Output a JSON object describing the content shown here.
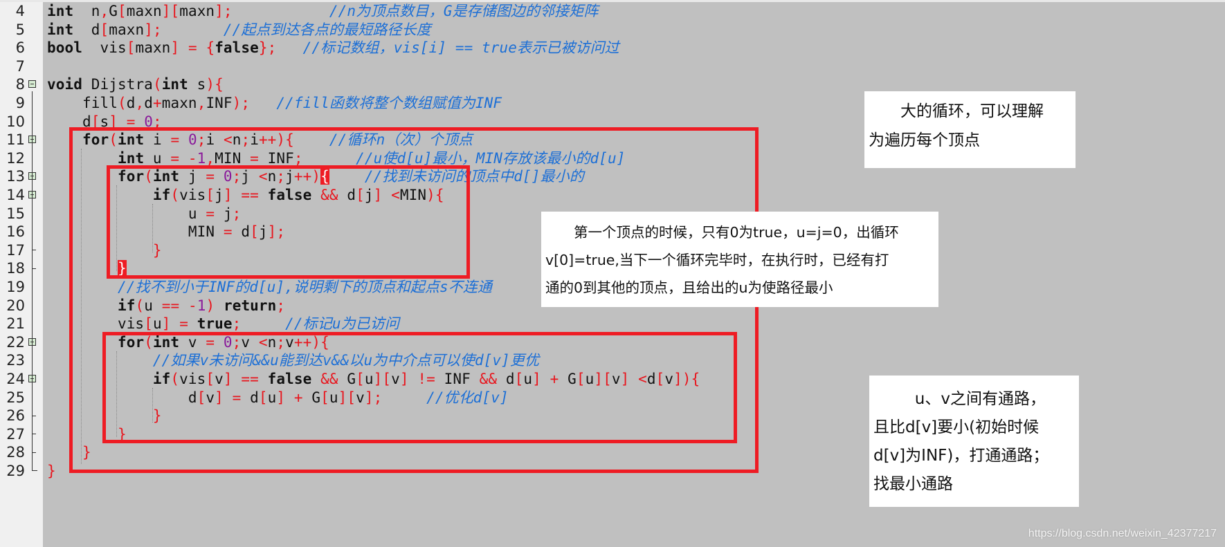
{
  "editor": {
    "lines": [
      {
        "n": "4",
        "fold": false,
        "tokens": [
          [
            "kw",
            "int"
          ],
          [
            "",
            "  n"
          ],
          [
            "op",
            ","
          ],
          [
            "",
            "G"
          ],
          [
            "op",
            "["
          ],
          [
            "",
            "maxn"
          ],
          [
            "op",
            "]["
          ],
          [
            "",
            "maxn"
          ],
          [
            "op",
            "];"
          ],
          [
            "",
            "           "
          ],
          [
            "cm",
            "//n为顶点数目，G是存储图边的邻接矩阵"
          ]
        ]
      },
      {
        "n": "5",
        "fold": false,
        "tokens": [
          [
            "kw",
            "int"
          ],
          [
            "",
            "  d"
          ],
          [
            "op",
            "["
          ],
          [
            "",
            "maxn"
          ],
          [
            "op",
            "];"
          ],
          [
            "",
            "       "
          ],
          [
            "cm",
            "//起点到达各点的最短路径长度"
          ]
        ]
      },
      {
        "n": "6",
        "fold": false,
        "tokens": [
          [
            "kw",
            "bool"
          ],
          [
            "",
            "  vis"
          ],
          [
            "op",
            "["
          ],
          [
            "",
            "maxn"
          ],
          [
            "op",
            "]"
          ],
          [
            "",
            " "
          ],
          [
            "op",
            "="
          ],
          [
            "",
            " "
          ],
          [
            "op",
            "{"
          ],
          [
            "kw",
            "false"
          ],
          [
            "op",
            "};"
          ],
          [
            "",
            "   "
          ],
          [
            "cm",
            "//标记数组，vis[i] == true表示已被访问过"
          ]
        ]
      },
      {
        "n": "7",
        "fold": false,
        "tokens": []
      },
      {
        "n": "8",
        "fold": true,
        "tokens": [
          [
            "kw",
            "void"
          ],
          [
            "",
            " Dijstra"
          ],
          [
            "op",
            "("
          ],
          [
            "kw",
            "int"
          ],
          [
            "",
            " s"
          ],
          [
            "op",
            "){"
          ]
        ]
      },
      {
        "n": "9",
        "fold": false,
        "tokens": [
          [
            "",
            "    fill"
          ],
          [
            "op",
            "("
          ],
          [
            "",
            "d"
          ],
          [
            "op",
            ","
          ],
          [
            "",
            "d"
          ],
          [
            "op",
            "+"
          ],
          [
            "",
            "maxn"
          ],
          [
            "op",
            ","
          ],
          [
            "",
            "INF"
          ],
          [
            "op",
            ");"
          ],
          [
            "",
            "   "
          ],
          [
            "cm",
            "//fill函数将整个数组赋值为INF"
          ]
        ]
      },
      {
        "n": "10",
        "fold": false,
        "tokens": [
          [
            "",
            "    d"
          ],
          [
            "op",
            "["
          ],
          [
            "",
            "s"
          ],
          [
            "op",
            "]"
          ],
          [
            "",
            " "
          ],
          [
            "op",
            "="
          ],
          [
            "",
            " "
          ],
          [
            "num",
            "0"
          ],
          [
            "op",
            ";"
          ]
        ]
      },
      {
        "n": "11",
        "fold": true,
        "tokens": [
          [
            "",
            "    "
          ],
          [
            "kw",
            "for"
          ],
          [
            "op",
            "("
          ],
          [
            "kw",
            "int"
          ],
          [
            "",
            " i "
          ],
          [
            "op",
            "="
          ],
          [
            "",
            " "
          ],
          [
            "num",
            "0"
          ],
          [
            "op",
            ";"
          ],
          [
            "",
            "i "
          ],
          [
            "op",
            "<"
          ],
          [
            "",
            "n"
          ],
          [
            "op",
            ";"
          ],
          [
            "",
            "i"
          ],
          [
            "op",
            "++){"
          ],
          [
            "",
            "    "
          ],
          [
            "cm",
            "//循环n（次）个顶点"
          ]
        ]
      },
      {
        "n": "12",
        "fold": false,
        "tokens": [
          [
            "",
            "        "
          ],
          [
            "kw",
            "int"
          ],
          [
            "",
            " u "
          ],
          [
            "op",
            "="
          ],
          [
            "",
            " "
          ],
          [
            "op",
            "-"
          ],
          [
            "num",
            "1"
          ],
          [
            "op",
            ","
          ],
          [
            "",
            "MIN "
          ],
          [
            "op",
            "="
          ],
          [
            "",
            " INF"
          ],
          [
            "op",
            ";"
          ],
          [
            "",
            "      "
          ],
          [
            "cm",
            "//u使d[u]最小，MIN存放该最小的d[u]"
          ]
        ]
      },
      {
        "n": "13",
        "fold": true,
        "tokens": [
          [
            "",
            "        "
          ],
          [
            "kw",
            "for"
          ],
          [
            "op",
            "("
          ],
          [
            "kw",
            "int"
          ],
          [
            "",
            " j "
          ],
          [
            "op",
            "="
          ],
          [
            "",
            " "
          ],
          [
            "num",
            "0"
          ],
          [
            "op",
            ";"
          ],
          [
            "",
            "j "
          ],
          [
            "op",
            "<"
          ],
          [
            "",
            "n"
          ],
          [
            "op",
            ";"
          ],
          [
            "",
            "j"
          ],
          [
            "op",
            "++)"
          ],
          [
            "hl",
            "{"
          ],
          [
            "",
            "    "
          ],
          [
            "cm",
            "//找到未访问的顶点中d[]最小的"
          ]
        ]
      },
      {
        "n": "14",
        "fold": true,
        "tokens": [
          [
            "",
            "            "
          ],
          [
            "kw",
            "if"
          ],
          [
            "op",
            "("
          ],
          [
            "",
            "vis"
          ],
          [
            "op",
            "["
          ],
          [
            "",
            "j"
          ],
          [
            "op",
            "]"
          ],
          [
            "",
            " "
          ],
          [
            "op",
            "=="
          ],
          [
            "",
            " "
          ],
          [
            "kw",
            "false"
          ],
          [
            "",
            " "
          ],
          [
            "op",
            "&&"
          ],
          [
            "",
            " d"
          ],
          [
            "op",
            "["
          ],
          [
            "",
            "j"
          ],
          [
            "op",
            "]"
          ],
          [
            "",
            " "
          ],
          [
            "op",
            "<"
          ],
          [
            "",
            "MIN"
          ],
          [
            "op",
            "){"
          ]
        ]
      },
      {
        "n": "15",
        "fold": false,
        "tokens": [
          [
            "",
            "                u "
          ],
          [
            "op",
            "="
          ],
          [
            "",
            " j"
          ],
          [
            "op",
            ";"
          ]
        ]
      },
      {
        "n": "16",
        "fold": false,
        "tokens": [
          [
            "",
            "                MIN "
          ],
          [
            "op",
            "="
          ],
          [
            "",
            " d"
          ],
          [
            "op",
            "["
          ],
          [
            "",
            "j"
          ],
          [
            "op",
            "];"
          ]
        ]
      },
      {
        "n": "17",
        "fold": false,
        "tokens": [
          [
            "",
            "            "
          ],
          [
            "op",
            "}"
          ]
        ]
      },
      {
        "n": "18",
        "fold": false,
        "tokens": [
          [
            "",
            "        "
          ],
          [
            "hl",
            "}"
          ]
        ]
      },
      {
        "n": "19",
        "fold": false,
        "tokens": [
          [
            "",
            "        "
          ],
          [
            "cm",
            "//找不到小于INF的d[u],说明剩下的顶点和起点s不连通"
          ]
        ]
      },
      {
        "n": "20",
        "fold": false,
        "tokens": [
          [
            "",
            "        "
          ],
          [
            "kw",
            "if"
          ],
          [
            "op",
            "("
          ],
          [
            "",
            "u "
          ],
          [
            "op",
            "=="
          ],
          [
            "",
            " "
          ],
          [
            "op",
            "-"
          ],
          [
            "num",
            "1"
          ],
          [
            "op",
            ")"
          ],
          [
            "",
            " "
          ],
          [
            "kw",
            "return"
          ],
          [
            "op",
            ";"
          ]
        ]
      },
      {
        "n": "21",
        "fold": false,
        "tokens": [
          [
            "",
            "        vis"
          ],
          [
            "op",
            "["
          ],
          [
            "",
            "u"
          ],
          [
            "op",
            "]"
          ],
          [
            "",
            " "
          ],
          [
            "op",
            "="
          ],
          [
            "",
            " "
          ],
          [
            "kw",
            "true"
          ],
          [
            "op",
            ";"
          ],
          [
            "",
            "     "
          ],
          [
            "cm",
            "//标记u为已访问"
          ]
        ]
      },
      {
        "n": "22",
        "fold": true,
        "tokens": [
          [
            "",
            "        "
          ],
          [
            "kw",
            "for"
          ],
          [
            "op",
            "("
          ],
          [
            "kw",
            "int"
          ],
          [
            "",
            " v "
          ],
          [
            "op",
            "="
          ],
          [
            "",
            " "
          ],
          [
            "num",
            "0"
          ],
          [
            "op",
            ";"
          ],
          [
            "",
            "v "
          ],
          [
            "op",
            "<"
          ],
          [
            "",
            "n"
          ],
          [
            "op",
            ";"
          ],
          [
            "",
            "v"
          ],
          [
            "op",
            "++){"
          ]
        ]
      },
      {
        "n": "23",
        "fold": false,
        "tokens": [
          [
            "",
            "            "
          ],
          [
            "cm",
            "//如果v未访问&&u能到达v&&以u为中介点可以使d[v]更优"
          ]
        ]
      },
      {
        "n": "24",
        "fold": true,
        "tokens": [
          [
            "",
            "            "
          ],
          [
            "kw",
            "if"
          ],
          [
            "op",
            "("
          ],
          [
            "",
            "vis"
          ],
          [
            "op",
            "["
          ],
          [
            "",
            "v"
          ],
          [
            "op",
            "]"
          ],
          [
            "",
            " "
          ],
          [
            "op",
            "=="
          ],
          [
            "",
            " "
          ],
          [
            "kw",
            "false"
          ],
          [
            "",
            " "
          ],
          [
            "op",
            "&&"
          ],
          [
            "",
            " G"
          ],
          [
            "op",
            "["
          ],
          [
            "",
            "u"
          ],
          [
            "op",
            "]["
          ],
          [
            "",
            "v"
          ],
          [
            "op",
            "]"
          ],
          [
            "",
            " "
          ],
          [
            "op",
            "!="
          ],
          [
            "",
            " INF "
          ],
          [
            "op",
            "&&"
          ],
          [
            "",
            " d"
          ],
          [
            "op",
            "["
          ],
          [
            "",
            "u"
          ],
          [
            "op",
            "]"
          ],
          [
            "",
            " "
          ],
          [
            "op",
            "+"
          ],
          [
            "",
            " G"
          ],
          [
            "op",
            "["
          ],
          [
            "",
            "u"
          ],
          [
            "op",
            "]["
          ],
          [
            "",
            "v"
          ],
          [
            "op",
            "]"
          ],
          [
            "",
            " "
          ],
          [
            "op",
            "<"
          ],
          [
            "",
            "d"
          ],
          [
            "op",
            "["
          ],
          [
            "",
            "v"
          ],
          [
            "op",
            "]){"
          ]
        ]
      },
      {
        "n": "25",
        "fold": false,
        "tokens": [
          [
            "",
            "                d"
          ],
          [
            "op",
            "["
          ],
          [
            "",
            "v"
          ],
          [
            "op",
            "]"
          ],
          [
            "",
            " "
          ],
          [
            "op",
            "="
          ],
          [
            "",
            " d"
          ],
          [
            "op",
            "["
          ],
          [
            "",
            "u"
          ],
          [
            "op",
            "]"
          ],
          [
            "",
            " "
          ],
          [
            "op",
            "+"
          ],
          [
            "",
            " G"
          ],
          [
            "op",
            "["
          ],
          [
            "",
            "u"
          ],
          [
            "op",
            "]["
          ],
          [
            "",
            "v"
          ],
          [
            "op",
            "];"
          ],
          [
            "",
            "     "
          ],
          [
            "cm",
            "//优化d[v]"
          ]
        ]
      },
      {
        "n": "26",
        "fold": false,
        "tokens": [
          [
            "",
            "            "
          ],
          [
            "op",
            "}"
          ]
        ]
      },
      {
        "n": "27",
        "fold": false,
        "tokens": [
          [
            "",
            "        "
          ],
          [
            "op",
            "}"
          ]
        ]
      },
      {
        "n": "28",
        "fold": false,
        "tokens": [
          [
            "",
            "    "
          ],
          [
            "op",
            "}"
          ]
        ]
      },
      {
        "n": "29",
        "fold": false,
        "tokens": [
          [
            "op",
            "}"
          ]
        ]
      }
    ]
  },
  "annotations": {
    "outer_loop": [
      "大的循环，可以理解",
      "为遍历每个顶点"
    ],
    "inner_loop": [
      "第一个顶点的时候，只有0为true，u=j=0，出循环",
      "v[0]=true,当下一个循环完毕时，在执行时，已经有打",
      "通的0到其他的顶点，且给出的u为使路径最小"
    ],
    "relax_loop": [
      "u、v之间有通路，",
      "且比d[v]要小(初始时候",
      "d[v]为INF)，打通通路；",
      "找最小通路"
    ]
  },
  "watermark": "https://blog.csdn.net/weixin_42377217",
  "colors": {
    "background": "#c0c0c0",
    "box_red": "#ee1c24",
    "comment_blue": "#1c6fd6",
    "operator_red": "#e8141c",
    "number_purple": "#8a1a9a"
  }
}
